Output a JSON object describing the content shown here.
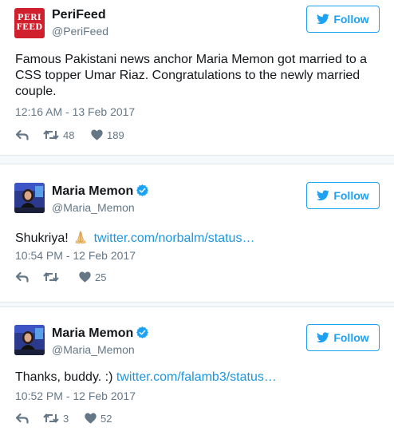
{
  "follow_label": "Follow",
  "colors": {
    "accent": "#1da1f2",
    "link": "#1b95e0",
    "muted": "#657786",
    "text": "#14171a",
    "peri_brand": "#d01f2d"
  },
  "tweets": [
    {
      "name": "PeriFeed",
      "handle": "@PeriFeed",
      "avatar_lines": [
        "PERI",
        "FEED"
      ],
      "verified": false,
      "text": "Famous Pakistani news anchor Maria Memon got married to a CSS topper Umar Riaz. Congratulations to the newly married couple.",
      "time": "12:16 AM - 13 Feb 2017",
      "retweets": "48",
      "likes": "189"
    },
    {
      "name": "Maria Memon",
      "handle": "@Maria_Memon",
      "verified": true,
      "text_before": "Shukriya!",
      "emoji": "folded-hands",
      "link": "twitter.com/norbalm/status…",
      "time": "10:54 PM - 12 Feb 2017",
      "retweets": "",
      "likes": "25"
    },
    {
      "name": "Maria Memon",
      "handle": "@Maria_Memon",
      "verified": true,
      "text_before": "Thanks, buddy. :)",
      "link": "twitter.com/falamb3/status…",
      "time": "10:52 PM - 12 Feb 2017",
      "retweets": "3",
      "likes": "52"
    }
  ]
}
